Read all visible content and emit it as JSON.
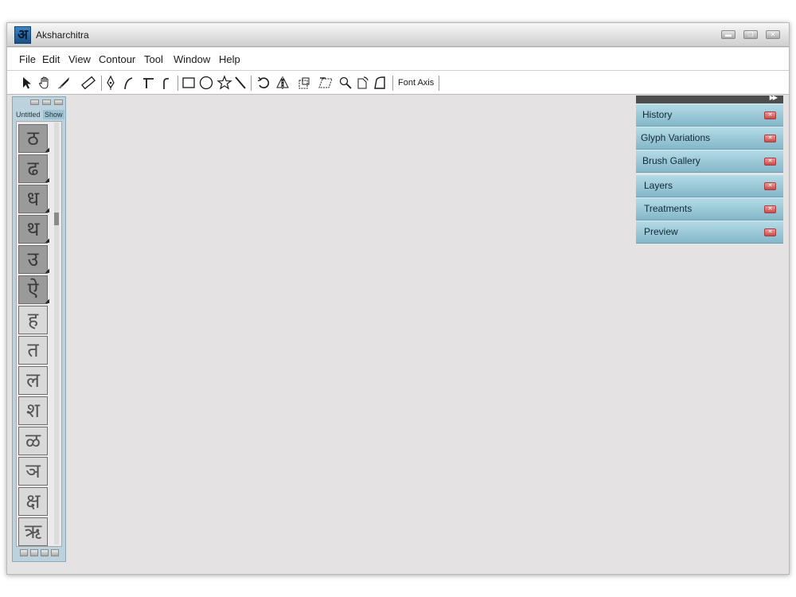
{
  "window": {
    "title": "Aksharchitra",
    "logo_glyph": "अ",
    "controls": [
      "minimize-icon",
      "maximize-icon",
      "close-icon"
    ]
  },
  "menu": [
    "File",
    "Edit",
    "View",
    "Contour",
    "Tool",
    "Window",
    "Help"
  ],
  "toolbar": {
    "tools": [
      "pointer-arrow-icon",
      "hand-icon",
      "knife-icon",
      "measure-icon",
      "pen-icon",
      "curve-icon",
      "tangent-icon",
      "corner-icon",
      "rectangle-icon",
      "ellipse-icon",
      "star-icon",
      "line-icon",
      "rotate-icon",
      "mirror-icon",
      "scale-icon",
      "skew-icon",
      "zoom-icon",
      "rotate-point-icon",
      "shape-icon"
    ],
    "font_axis_label": "Font Axis"
  },
  "glyph_panel": {
    "tabs": [
      "Untitled",
      "Show"
    ],
    "active_tab": "Show",
    "glyphs": [
      {
        "char": "ठ",
        "style": "dark"
      },
      {
        "char": "ढ",
        "style": "dark"
      },
      {
        "char": "ध",
        "style": "dark"
      },
      {
        "char": "थ",
        "style": "dark"
      },
      {
        "char": "उ",
        "style": "dark"
      },
      {
        "char": "ऐ",
        "style": "dark"
      },
      {
        "char": "ह",
        "style": "light"
      },
      {
        "char": "त",
        "style": "light"
      },
      {
        "char": "ल",
        "style": "light"
      },
      {
        "char": "श",
        "style": "light"
      },
      {
        "char": "ळ",
        "style": "light"
      },
      {
        "char": "ञ",
        "style": "light"
      },
      {
        "char": "क्ष",
        "style": "light"
      },
      {
        "char": "ऋ",
        "style": "light"
      }
    ]
  },
  "right_panel": {
    "items": [
      "History",
      "Glyph Variations",
      "Brush Gallery",
      "Layers",
      "Treatments",
      "Preview"
    ]
  },
  "colors": {
    "canvas": "#e4e2e3",
    "panel_accent": "#9ec8d7",
    "close_red": "#d45a5a"
  }
}
